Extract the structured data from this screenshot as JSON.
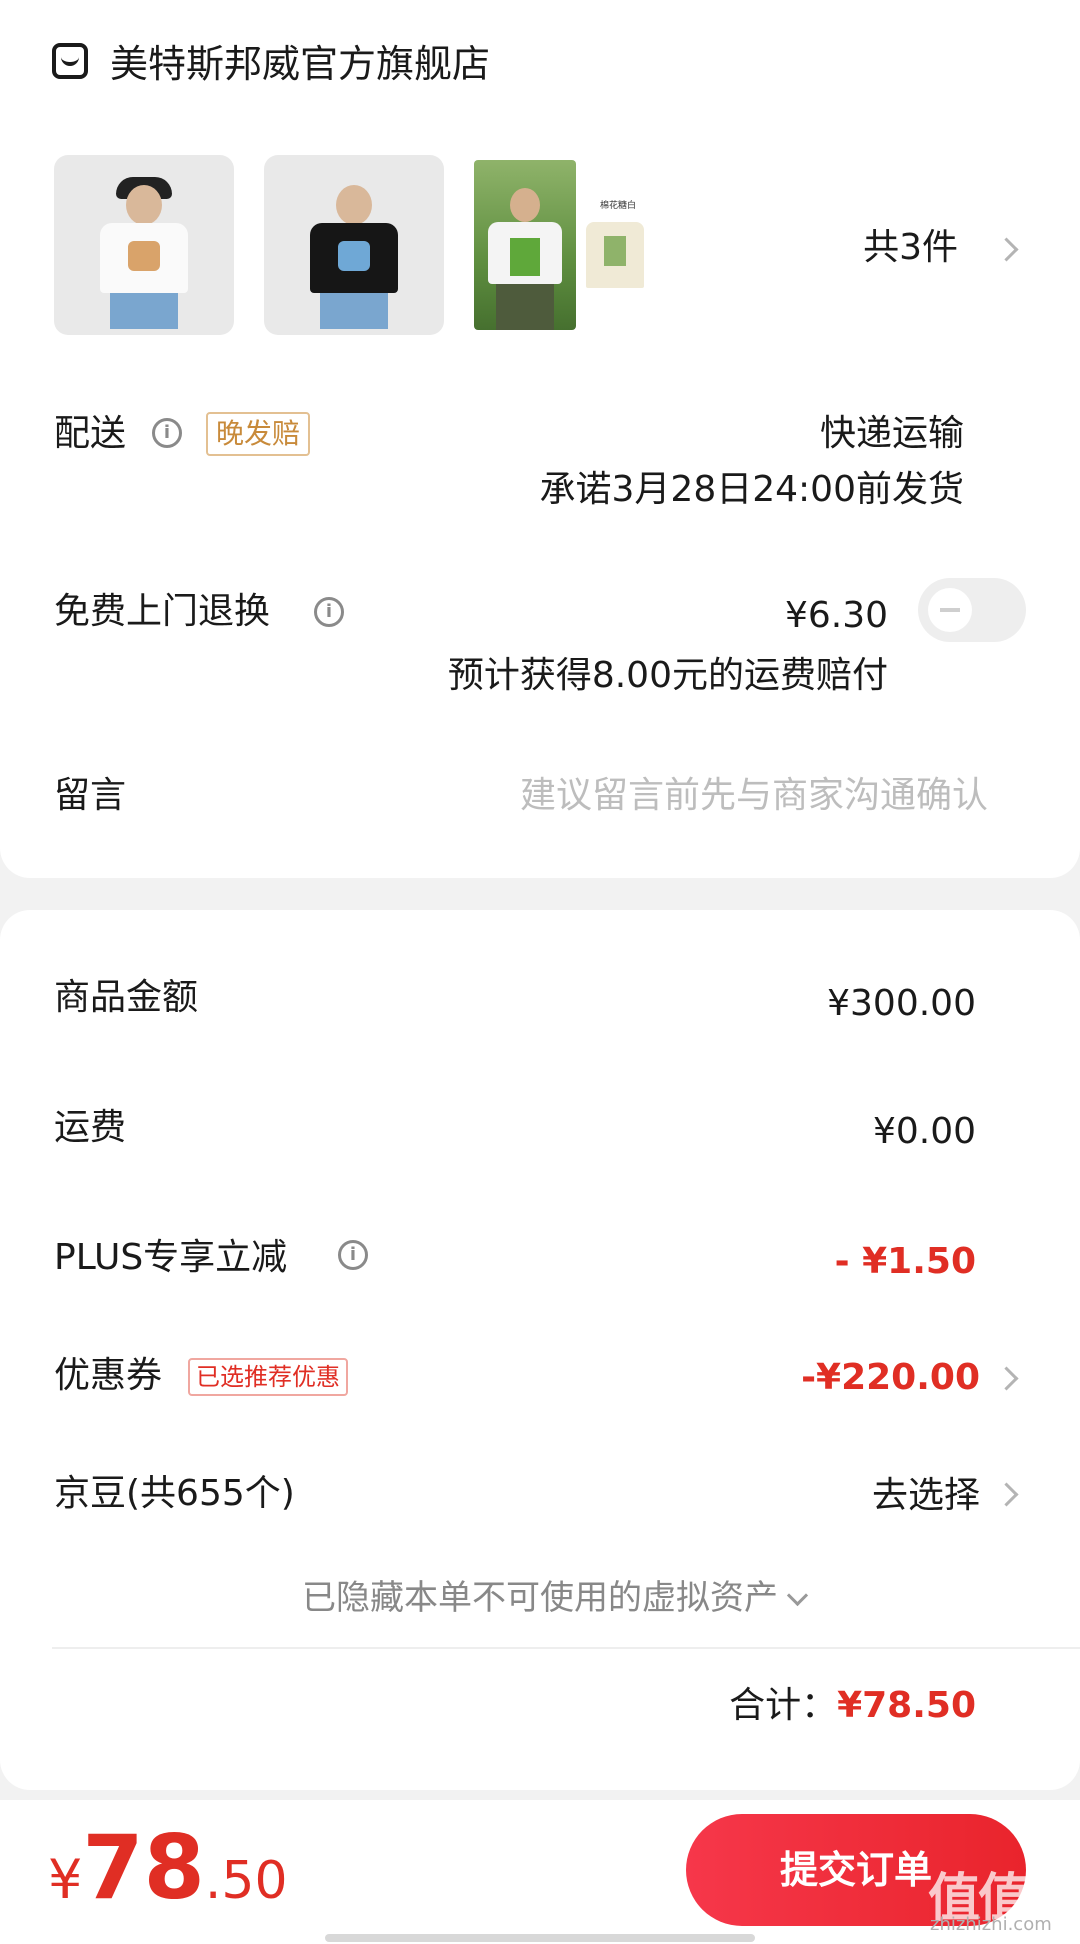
{
  "store": {
    "name": "美特斯邦威官方旗舰店",
    "icon": "store-icon"
  },
  "products": {
    "thumbnails": [
      "product-1",
      "product-2",
      "product-3"
    ],
    "thumb3_caption": "棉花糖白",
    "count": "共3件"
  },
  "delivery": {
    "label": "配送",
    "tag": "晚发赔",
    "method": "快递运输",
    "promise": "承诺3月28日24:00前发货"
  },
  "return_service": {
    "label": "免费上门退换",
    "price": "¥6.30",
    "note": "预计获得8.00元的运费赔付",
    "enabled": false
  },
  "message": {
    "label": "留言",
    "placeholder": "建议留言前先与商家沟通确认"
  },
  "summary": {
    "goods_amount_label": "商品金额",
    "goods_amount": "¥300.00",
    "shipping_label": "运费",
    "shipping": "¥0.00",
    "plus_label": "PLUS专享立减",
    "plus_discount": "- ¥1.50",
    "coupon_label": "优惠券",
    "coupon_tag": "已选推荐优惠",
    "coupon_discount": "-¥220.00",
    "jd_beans_label": "京豆(共655个)",
    "jd_beans_action": "去选择",
    "hidden_assets": "已隐藏本单不可使用的虚拟资产",
    "total_label": "合计：",
    "total": "¥78.50"
  },
  "bottom": {
    "currency": "¥",
    "total_int": "78",
    "total_dec": ".50",
    "submit_label": "提交订单",
    "watermark": "值值值",
    "watermark_sub": "zhizhizhi.com"
  },
  "colors": {
    "accent_red": "#e02e24",
    "tag_gold": "#c88a3a"
  }
}
